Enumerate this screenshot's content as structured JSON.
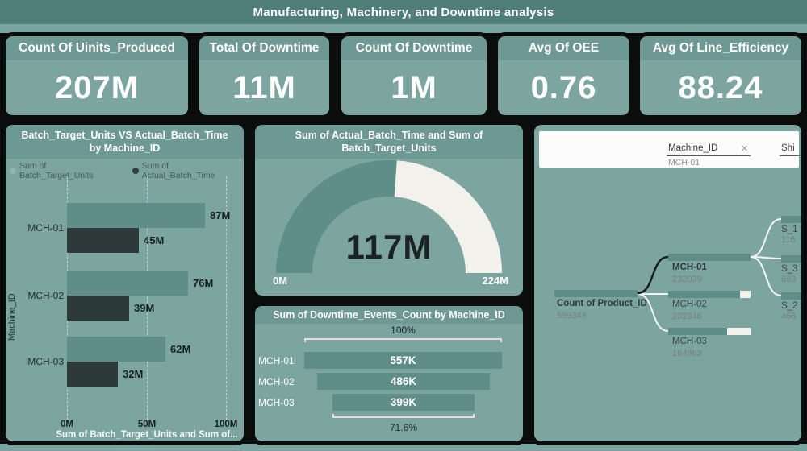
{
  "title": "Manufacturing, Machinery, and Downtime analysis",
  "kpis": [
    {
      "label": "Count Of Uinits_Produced",
      "value": "207M"
    },
    {
      "label": "Total Of Downtime",
      "value": "11M"
    },
    {
      "label": "Count Of Downtime",
      "value": "1M"
    },
    {
      "label": "Avg Of OEE",
      "value": "0.76"
    },
    {
      "label": "Avg Of Line_Efficiency",
      "value": "88.24"
    }
  ],
  "colors": {
    "title_bar": "#4f7e79",
    "page_strip": "#7aa49f",
    "border_black": "#0b0c0c",
    "panel_bg": "#7da5a0",
    "header_bg": "#6e9893",
    "teal_bar": "#5f8e89",
    "dark_bar": "#2d3a39",
    "gauge_rest": "#f2f1ec"
  },
  "chart_data": [
    {
      "type": "bar",
      "orientation": "horizontal",
      "title": "Batch_Target_Units VS Actual_Batch_Time by Machine_ID",
      "categories": [
        "MCH-01",
        "MCH-02",
        "MCH-03"
      ],
      "series": [
        {
          "name": "Sum of Batch_Target_Units",
          "values": [
            87,
            76,
            62
          ],
          "labels": [
            "87M",
            "76M",
            "62M"
          ],
          "color": "#5f8e89"
        },
        {
          "name": "Sum of Actual_Batch_Time",
          "values": [
            45,
            39,
            32
          ],
          "labels": [
            "45M",
            "39M",
            "32M"
          ],
          "color": "#2d3a39"
        }
      ],
      "xlabel": "Sum of Batch_Target_Units and Sum of...",
      "ylabel": "Machine_ID",
      "xticks": [
        "0M",
        "50M",
        "100M"
      ],
      "xlim": [
        0,
        100
      ],
      "unit": "M",
      "grid": "vertical-dashed",
      "legend_position": "top-left"
    },
    {
      "type": "gauge",
      "title": "Sum of Actual_Batch_Time and Sum of Batch_Target_Units",
      "value": 117,
      "value_label": "117M",
      "min": 0,
      "min_label": "0M",
      "max": 224,
      "max_label": "224M"
    },
    {
      "type": "funnel",
      "title": "Sum of Downtime_Events_Count by Machine_ID",
      "categories": [
        "MCH-01",
        "MCH-02",
        "MCH-03"
      ],
      "values": [
        557000,
        486000,
        399000
      ],
      "labels": [
        "557K",
        "486K",
        "399K"
      ],
      "top_percent": "100%",
      "bottom_percent": "71.6%"
    },
    {
      "type": "tree",
      "header": {
        "field1": "Machine_ID",
        "field1_value": "MCH-01",
        "close_icon": "✕",
        "field2": "Shi"
      },
      "root": {
        "label": "Count of Product_ID",
        "value": "599348",
        "value_num": 599348
      },
      "level1": [
        {
          "label": "MCH-01",
          "value": "232039",
          "value_num": 232039,
          "selected": true
        },
        {
          "label": "MCH-02",
          "value": "202346",
          "value_num": 202346,
          "selected": false
        },
        {
          "label": "MCH-03",
          "value": "164963",
          "value_num": 164963,
          "selected": false
        }
      ],
      "level2": [
        {
          "label": "S_1",
          "value": "116"
        },
        {
          "label": "S_3",
          "value": "693"
        },
        {
          "label": "S_2",
          "value": "466"
        }
      ]
    }
  ]
}
